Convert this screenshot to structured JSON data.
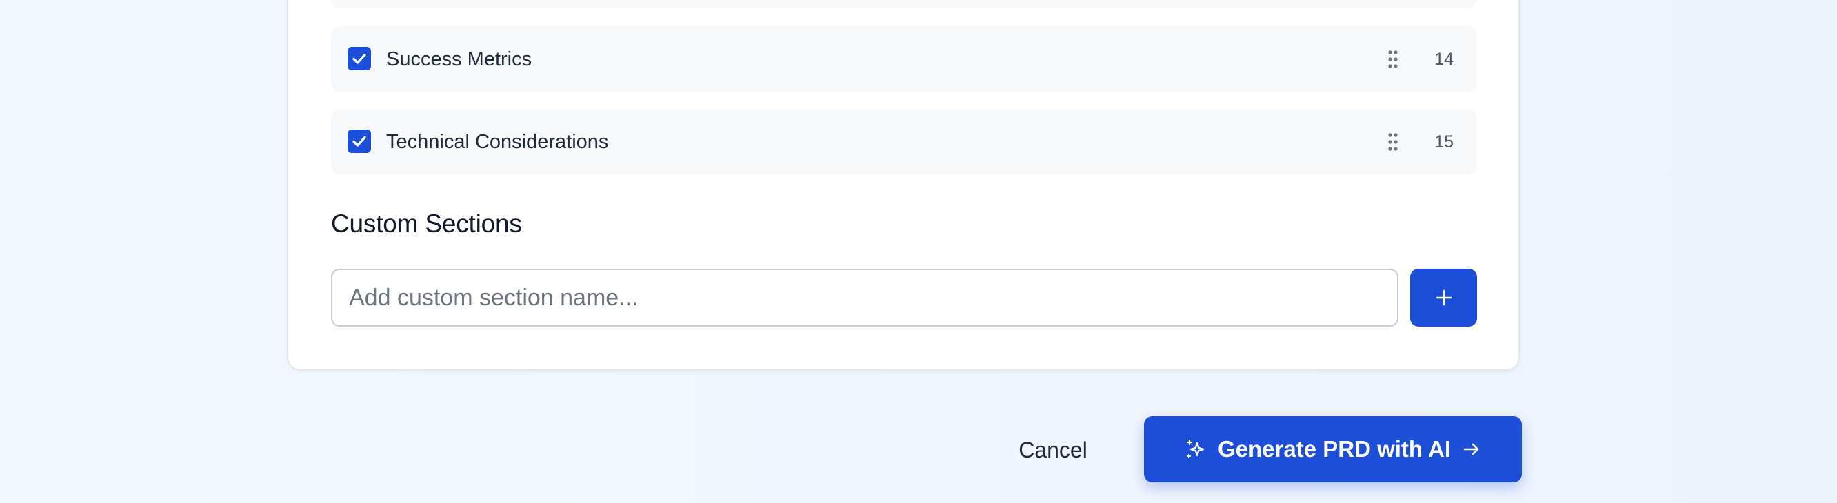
{
  "sections": [
    {
      "label": "Success Metrics",
      "number": "14",
      "checked": true
    },
    {
      "label": "Technical Considerations",
      "number": "15",
      "checked": true
    }
  ],
  "custom_sections": {
    "heading": "Custom Sections",
    "input_placeholder": "Add custom section name...",
    "input_value": "",
    "add_icon": "plus-icon"
  },
  "footer": {
    "cancel_label": "Cancel",
    "generate_label": "Generate PRD with AI",
    "generate_icon": "sparkles-icon",
    "generate_trailing_icon": "arrow-right-icon"
  },
  "colors": {
    "accent": "#1d4ed8",
    "row_background": "#f7f8fa",
    "page_background": "#f1f5fd"
  }
}
